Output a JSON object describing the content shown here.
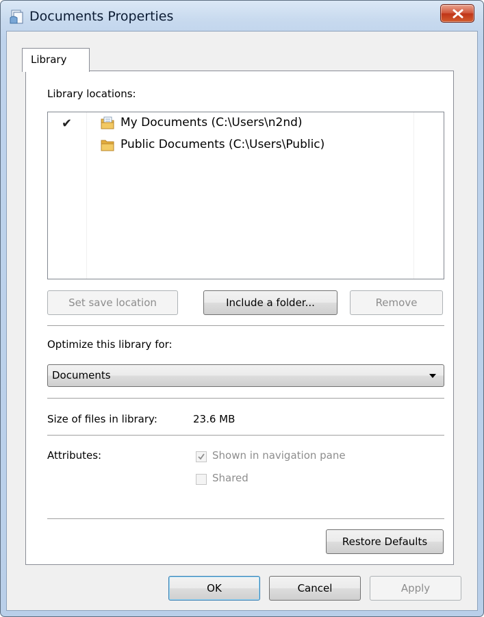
{
  "window": {
    "title": "Documents Properties",
    "title_icon": "library-documents-icon",
    "close_icon": "close-icon"
  },
  "tabs": [
    {
      "label": "Library",
      "selected": true
    }
  ],
  "library": {
    "locations_label": "Library locations:",
    "locations": [
      {
        "name": "My Documents (C:\\Users\\n2nd)",
        "icon": "documents-folder-icon",
        "default_save": true
      },
      {
        "name": "Public Documents (C:\\Users\\Public)",
        "icon": "folder-icon",
        "default_save": false
      }
    ],
    "checkmark": "✔",
    "buttons": {
      "set_save_location": "Set save location",
      "include_folder": "Include a folder...",
      "remove": "Remove"
    }
  },
  "optimize": {
    "label": "Optimize this library for:",
    "selected": "Documents"
  },
  "size": {
    "label": "Size of files in library:",
    "value": "23.6 MB"
  },
  "attributes": {
    "label": "Attributes:",
    "shown_in_navigation_pane": {
      "label": "Shown in navigation pane",
      "checked": true,
      "enabled": false
    },
    "shared": {
      "label": "Shared",
      "checked": false,
      "enabled": false
    }
  },
  "restore_defaults": "Restore Defaults",
  "footer": {
    "ok": "OK",
    "cancel": "Cancel",
    "apply": "Apply"
  },
  "colors": {
    "titlebar": "#c7d9ee",
    "close_button": "#c7402a",
    "default_button_border": "#3c7fb1",
    "disabled_text": "#8d8d8d"
  }
}
